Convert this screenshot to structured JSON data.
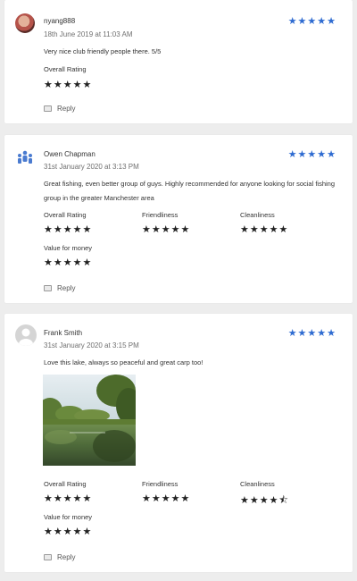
{
  "reviews": [
    {
      "author": "nyang888",
      "date": "18th June 2019 at 11:03 AM",
      "overall_stars": "★★★★★",
      "text": "Very nice club friendly people there. 5/5",
      "ratings": [
        {
          "label": "Overall Rating",
          "stars": "★★★★★",
          "value": 5
        }
      ],
      "reply_label": "Reply"
    },
    {
      "author": "Owen Chapman",
      "date": "31st January 2020 at 3:13 PM",
      "overall_stars": "★★★★★",
      "text": "Great fishing, even better group of guys. Highly recommended for anyone looking for social fishing group in the greater Manchester area",
      "ratings": [
        {
          "label": "Overall Rating",
          "stars": "★★★★★",
          "value": 5
        },
        {
          "label": "Friendliness",
          "stars": "★★★★★",
          "value": 5
        },
        {
          "label": "Cleanliness",
          "stars": "★★★★★",
          "value": 5
        },
        {
          "label": "Value for money",
          "stars": "★★★★★",
          "value": 5
        }
      ],
      "reply_label": "Reply"
    },
    {
      "author": "Frank Smith",
      "date": "31st January 2020 at 3:15 PM",
      "overall_stars": "★★★★★",
      "text": "Love this lake, always so peaceful and great carp too!",
      "ratings": [
        {
          "label": "Overall Rating",
          "stars": "★★★★★",
          "value": 5
        },
        {
          "label": "Friendliness",
          "stars": "★★★★★",
          "value": 5
        },
        {
          "label": "Cleanliness",
          "stars": "★★★★⯪",
          "value": 4.5
        },
        {
          "label": "Value for money",
          "stars": "★★★★★",
          "value": 5
        }
      ],
      "reply_label": "Reply"
    }
  ],
  "colors": {
    "page_background": "#ededed",
    "card_background": "#ffffff",
    "header_star_color": "#2e6bd1",
    "rating_star_color": "#222222"
  },
  "icons": {
    "avatar_1": "user-photo-avatar",
    "avatar_2": "group-people-icon",
    "avatar_3": "default-user-avatar",
    "reply": "comment-icon"
  }
}
